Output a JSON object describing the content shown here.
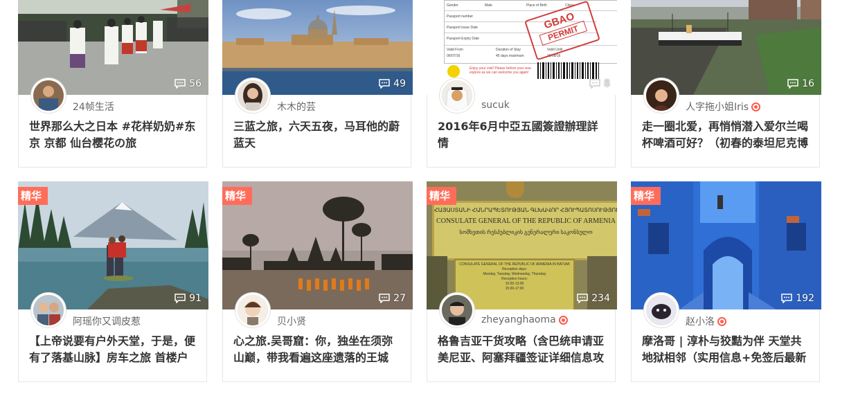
{
  "badge_label": "精华",
  "cards": [
    {
      "author": "24帧生活",
      "comments": "56",
      "title": "世界那么大之日本 #花样奶奶#东京 京都 仙台樱花の旅",
      "featured": false,
      "verified": false
    },
    {
      "author": "木木的芸",
      "comments": "49",
      "title": "三蓝之旅，六天五夜，马耳他的蔚蓝天",
      "featured": false,
      "verified": false
    },
    {
      "author": "sucuk",
      "comments": "8",
      "title": "2016年6月中亞五國簽證辦理詳情",
      "featured": false,
      "verified": false,
      "visa_doc": {
        "fields": [
          "Gender",
          "Male",
          "Place of Birth",
          "China",
          "Passport number",
          "Passport Issue Date",
          "Passport Expiry Date",
          "Valid From",
          "Duration of Stay",
          "Valid Until",
          "06/07/16",
          "45 days maximum",
          "19/08/16"
        ],
        "stamp_line1": "GBAO",
        "stamp_line2": "PERMIT",
        "note": "Enjoy your visit! Please before your visa expires as we can welcome you again!"
      }
    },
    {
      "author": "人字拖小姐Iris",
      "comments": "16",
      "title": "走一圈北爱，再悄悄潜入爱尔兰喝杯啤酒可好？（初春的泰坦尼克博",
      "featured": false,
      "verified": true
    },
    {
      "author": "阿瑶你又调皮惹",
      "comments": "91",
      "title": "【上帝说要有户外天堂，于是，便有了落基山脉】房车之旅 首楼户",
      "featured": true,
      "verified": false
    },
    {
      "author": "贝小贤",
      "comments": "27",
      "title": "心之旅.吴哥窟：你，独坐在须弥山巅，带我看遍这座遗落的王城",
      "featured": true,
      "verified": false
    },
    {
      "author": "zheyanghaoma",
      "comments": "234",
      "title": "格鲁吉亚干货攻略（含巴统申请亚美尼亚、阿塞拜疆签证详细信息攻",
      "featured": true,
      "verified": true,
      "sign_text": {
        "line1": "ՀԱՅԱՍՏԱՆԻ ՀԱՆՐԱՊԵՏՈՒԹՅԱՆ ԳԼԽԱՎՈՐ ՀՅՈՒՊԱՏՈՍՈՒԹՅՈՒՆ",
        "line2": "CONSULATE GENERAL OF THE REPUBLIC OF ARMENIA",
        "line3": "სომხეთის რესპუბლიკის გენერალური საკონსულო",
        "plaque": [
          "CONSULATE GENERAL OF THE REPUBLIC OF ARMENIA IN BATUMI",
          "Reception days:",
          "Monday, Tuesday, Wednesday, Thursday",
          "Reception hours:",
          "10:00-13:00",
          "15:00-17:00"
        ]
      }
    },
    {
      "author": "赵小洛",
      "comments": "192",
      "title": "摩洛哥 | 淳朴与狡黠为伴 天堂共地狱相邻（实用信息+免签后最新",
      "featured": true,
      "verified": true
    }
  ]
}
